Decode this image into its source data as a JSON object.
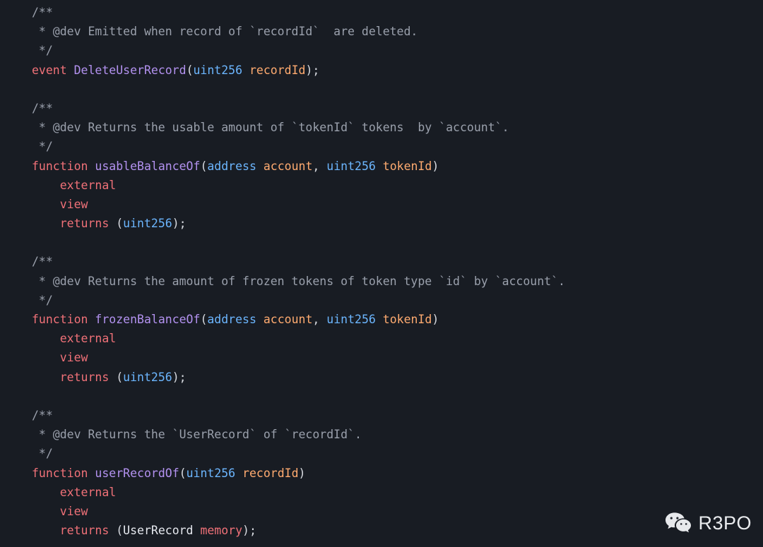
{
  "editor": {
    "language": "solidity",
    "background_color": "#181c23",
    "colors": {
      "comment": "#9aa0ac",
      "keyword": "#f07178",
      "function_name": "#b392f0",
      "type": "#6cb6ff",
      "parameter": "#ffab70",
      "punctuation": "#d7dae0",
      "plain": "#e6e9ef"
    },
    "lines": [
      {
        "tokens": [
          {
            "t": "/**",
            "c": "cmt"
          }
        ]
      },
      {
        "tokens": [
          {
            "t": " * @dev Emitted when record of `recordId`  are deleted.",
            "c": "cmt"
          }
        ]
      },
      {
        "tokens": [
          {
            "t": " */",
            "c": "cmt"
          }
        ]
      },
      {
        "tokens": [
          {
            "t": "event",
            "c": "kw"
          },
          {
            "t": " ",
            "c": "pln"
          },
          {
            "t": "DeleteUserRecord",
            "c": "fn"
          },
          {
            "t": "(",
            "c": "pun"
          },
          {
            "t": "uint256",
            "c": "typ"
          },
          {
            "t": " ",
            "c": "pln"
          },
          {
            "t": "recordId",
            "c": "var"
          },
          {
            "t": ");",
            "c": "pun"
          }
        ]
      },
      {
        "tokens": []
      },
      {
        "tokens": [
          {
            "t": "/**",
            "c": "cmt"
          }
        ]
      },
      {
        "tokens": [
          {
            "t": " * @dev Returns the usable amount of `tokenId` tokens  by `account`.",
            "c": "cmt"
          }
        ]
      },
      {
        "tokens": [
          {
            "t": " */",
            "c": "cmt"
          }
        ]
      },
      {
        "tokens": [
          {
            "t": "function",
            "c": "kw"
          },
          {
            "t": " ",
            "c": "pln"
          },
          {
            "t": "usableBalanceOf",
            "c": "fn"
          },
          {
            "t": "(",
            "c": "pun"
          },
          {
            "t": "address",
            "c": "typ"
          },
          {
            "t": " ",
            "c": "pln"
          },
          {
            "t": "account",
            "c": "var"
          },
          {
            "t": ", ",
            "c": "pun"
          },
          {
            "t": "uint256",
            "c": "typ"
          },
          {
            "t": " ",
            "c": "pln"
          },
          {
            "t": "tokenId",
            "c": "var"
          },
          {
            "t": ")",
            "c": "pun"
          }
        ]
      },
      {
        "tokens": [
          {
            "t": "    external",
            "c": "kw"
          }
        ]
      },
      {
        "tokens": [
          {
            "t": "    view",
            "c": "kw"
          }
        ]
      },
      {
        "tokens": [
          {
            "t": "    returns",
            "c": "kw"
          },
          {
            "t": " ",
            "c": "pln"
          },
          {
            "t": "(",
            "c": "pun"
          },
          {
            "t": "uint256",
            "c": "typ"
          },
          {
            "t": ");",
            "c": "pun"
          }
        ]
      },
      {
        "tokens": []
      },
      {
        "tokens": [
          {
            "t": "/**",
            "c": "cmt"
          }
        ]
      },
      {
        "tokens": [
          {
            "t": " * @dev Returns the amount of frozen tokens of token type `id` by `account`.",
            "c": "cmt"
          }
        ]
      },
      {
        "tokens": [
          {
            "t": " */",
            "c": "cmt"
          }
        ]
      },
      {
        "tokens": [
          {
            "t": "function",
            "c": "kw"
          },
          {
            "t": " ",
            "c": "pln"
          },
          {
            "t": "frozenBalanceOf",
            "c": "fn"
          },
          {
            "t": "(",
            "c": "pun"
          },
          {
            "t": "address",
            "c": "typ"
          },
          {
            "t": " ",
            "c": "pln"
          },
          {
            "t": "account",
            "c": "var"
          },
          {
            "t": ", ",
            "c": "pun"
          },
          {
            "t": "uint256",
            "c": "typ"
          },
          {
            "t": " ",
            "c": "pln"
          },
          {
            "t": "tokenId",
            "c": "var"
          },
          {
            "t": ")",
            "c": "pun"
          }
        ]
      },
      {
        "tokens": [
          {
            "t": "    external",
            "c": "kw"
          }
        ]
      },
      {
        "tokens": [
          {
            "t": "    view",
            "c": "kw"
          }
        ]
      },
      {
        "tokens": [
          {
            "t": "    returns",
            "c": "kw"
          },
          {
            "t": " ",
            "c": "pln"
          },
          {
            "t": "(",
            "c": "pun"
          },
          {
            "t": "uint256",
            "c": "typ"
          },
          {
            "t": ");",
            "c": "pun"
          }
        ]
      },
      {
        "tokens": []
      },
      {
        "tokens": [
          {
            "t": "/**",
            "c": "cmt"
          }
        ]
      },
      {
        "tokens": [
          {
            "t": " * @dev Returns the `UserRecord` of `recordId`.",
            "c": "cmt"
          }
        ]
      },
      {
        "tokens": [
          {
            "t": " */",
            "c": "cmt"
          }
        ]
      },
      {
        "tokens": [
          {
            "t": "function",
            "c": "kw"
          },
          {
            "t": " ",
            "c": "pln"
          },
          {
            "t": "userRecordOf",
            "c": "fn"
          },
          {
            "t": "(",
            "c": "pun"
          },
          {
            "t": "uint256",
            "c": "typ"
          },
          {
            "t": " ",
            "c": "pln"
          },
          {
            "t": "recordId",
            "c": "var"
          },
          {
            "t": ")",
            "c": "pun"
          }
        ]
      },
      {
        "tokens": [
          {
            "t": "    external",
            "c": "kw"
          }
        ]
      },
      {
        "tokens": [
          {
            "t": "    view",
            "c": "kw"
          }
        ]
      },
      {
        "tokens": [
          {
            "t": "    returns",
            "c": "kw"
          },
          {
            "t": " ",
            "c": "pln"
          },
          {
            "t": "(",
            "c": "pun"
          },
          {
            "t": "UserRecord",
            "c": "pln"
          },
          {
            "t": " ",
            "c": "pln"
          },
          {
            "t": "memory",
            "c": "kw"
          },
          {
            "t": ");",
            "c": "pun"
          }
        ]
      }
    ]
  },
  "watermark": {
    "icon": "wechat-icon",
    "label": "R3PO",
    "text_color": "#f2f4f7"
  }
}
